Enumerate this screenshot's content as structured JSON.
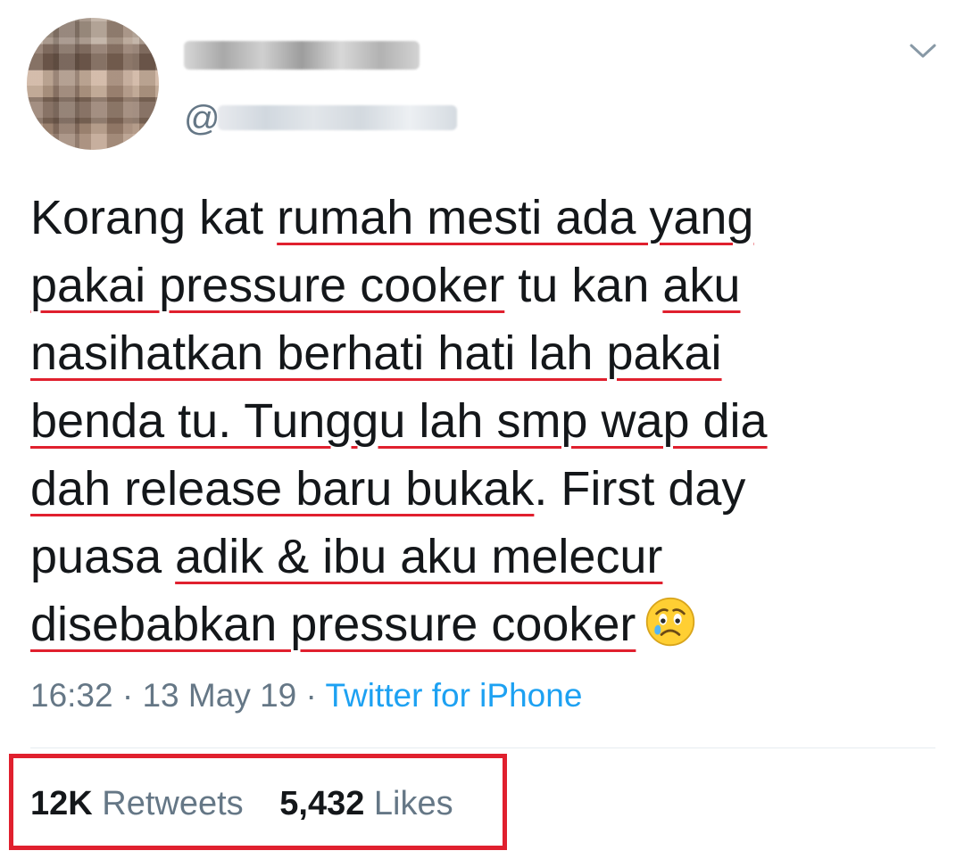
{
  "tweet": {
    "handle_prefix": "@",
    "segments": [
      {
        "text": "Korang kat ",
        "underline": false
      },
      {
        "text": "rumah mesti ada yang pakai pressure cooker",
        "underline": true
      },
      {
        "text": " tu kan ",
        "underline": false
      },
      {
        "text": "aku nasihatkan berhati hati lah pakai benda tu. Tunggu lah smp wap dia dah release baru bukak",
        "underline": true
      },
      {
        "text": ". First day puasa ",
        "underline": false
      },
      {
        "text": "adik & ibu aku melecur disebabkan pressure cooker",
        "underline": true
      }
    ],
    "emoji": "crying-face",
    "time": "16:32",
    "dot1": " · ",
    "date": "13 May 19",
    "dot2": " · ",
    "source": "Twitter for iPhone"
  },
  "stats": {
    "retweets_count": "12K",
    "retweets_label": "Retweets",
    "likes_count": "5,432",
    "likes_label": "Likes"
  },
  "colors": {
    "annotation_red": "#e0202e",
    "link_blue": "#1da1f2",
    "secondary_text": "#657786"
  }
}
